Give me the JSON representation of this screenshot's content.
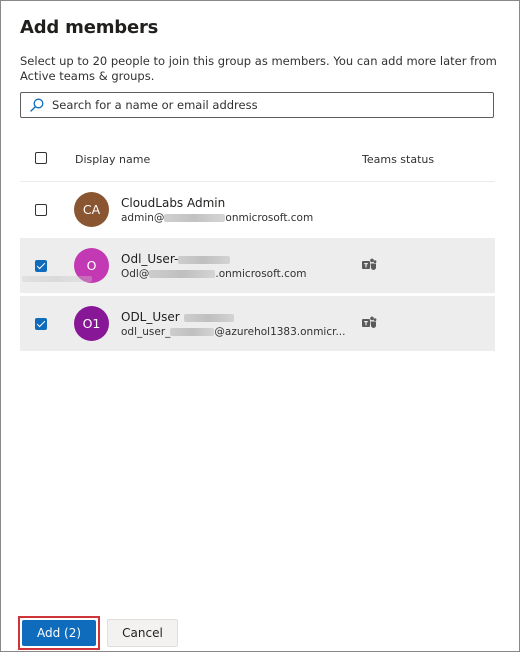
{
  "dialog": {
    "title": "Add members",
    "description": "Select up to 20 people to join this group as members. You can add more later from Active teams & groups.",
    "search_placeholder": "Search for a name or email address"
  },
  "table": {
    "headers": {
      "display_name": "Display name",
      "teams_status": "Teams status"
    },
    "rows": [
      {
        "initials": "CA",
        "avatar_color": "#8a5631",
        "name": "CloudLabs Admin",
        "email_prefix": "admin@",
        "email_suffix": "onmicrosoft.com",
        "checked": false,
        "teams_icon": false
      },
      {
        "initials": "O",
        "avatar_color": "#c239b3",
        "name": "Odl_User-",
        "email_prefix": "Odl@",
        "email_suffix": ".onmicrosoft.com",
        "checked": true,
        "teams_icon": true
      },
      {
        "initials": "O1",
        "avatar_color": "#881798",
        "name": "ODL_User",
        "email_prefix": "odl_user_",
        "email_suffix": "@azurehol1383.onmicr...",
        "checked": true,
        "teams_icon": true
      }
    ]
  },
  "footer": {
    "add_label": "Add (2)",
    "cancel_label": "Cancel"
  },
  "colors": {
    "primary": "#0f6cbd",
    "highlight_outline": "#d13438",
    "selected_row": "#ededed"
  }
}
